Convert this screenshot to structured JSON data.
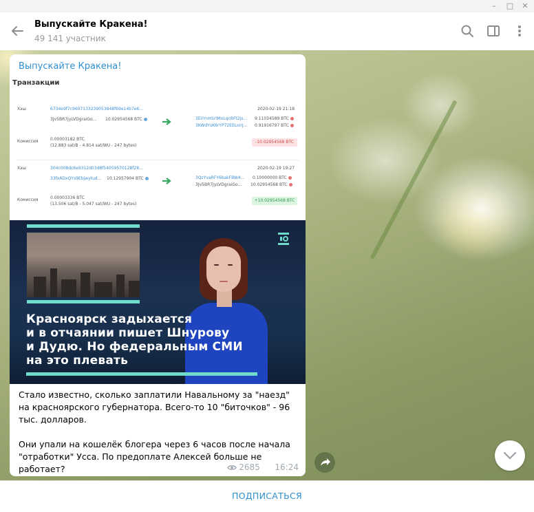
{
  "window": {
    "minimize": "–",
    "maximize": "□",
    "close": "✕"
  },
  "header": {
    "title": "Выпускайте Кракена!",
    "subtitle": "49 141 участник"
  },
  "message": {
    "channel_name": "Выпускайте Кракена!",
    "document": {
      "title": "Транзакции",
      "tx1": {
        "hash_label": "Хэш",
        "hash": "6734e9f7c9607133239053848f69e14b7e6...",
        "date": "2020-02-19 21:18",
        "from_addr": "3Jv5BR7JyLVDgraiGo...",
        "from_amount": "10.02954568 BTC",
        "out1_addr": "3EiiYnHSrtMoLqcBFt2js...",
        "out1_amount": "9.11034589 BTC",
        "out2_addr": "3KWdYsK6rYP72EELoirJ...",
        "out2_amount": "0.91916797 BTC",
        "fee_label": "Комиссия",
        "fee": "0.00003182 BTC",
        "fee_detail": "(12.883 sat/B - 4.814 sat/WU - 247 bytes)",
        "total": "-10.02954568 BTC"
      },
      "tx2": {
        "hash_label": "Хэш",
        "hash": "304c008dc6e9312d03d8f54059570128f28...",
        "date": "2020-02-19 19:27",
        "from_addr": "33fxADxQYs9Ebjwytud...",
        "from_amount": "10.12957904 BTC",
        "out1_addr": "3QzYvaRFY6bakFBW4...",
        "out1_amount": "0.10000000 BTC",
        "out2_addr": "3Jv5BR7JyLVDgraiGo...",
        "out2_amount": "10.02954568 BTC",
        "fee_label": "Комиссия",
        "fee": "0.00003336 BTC",
        "fee_detail": "(13.506 sat/B - 5.047 sat/WU - 247 bytes)",
        "total": "+10.02954568 BTC"
      }
    },
    "video": {
      "headline_lines": [
        "Красноярск задыхается",
        "и в отчаянии пишет Шнурову",
        "и Дудю. Но федеральным СМИ",
        "на это плевать"
      ]
    },
    "caption_p1": "Стало известно, сколько заплатили Навальному за \"наезд\" на красноярского губернатора. Всего-то 10 \"биточков\" - 96 тыс. долларов.",
    "caption_p2": "Они упали на кошелёк блогера через 6 часов после начала \"отработки\" Усса. По предоплате Алексей больше не работает?",
    "views": "2685",
    "time": "16:24"
  },
  "footer": {
    "subscribe_label": "ПОДПИСАТЬСЯ"
  },
  "colors": {
    "accent": "#2f8ed0",
    "fee_negative": "#d04848",
    "fee_positive": "#2e9a4c",
    "video_line": "#6fdccb"
  },
  "icons": [
    "back-arrow-icon",
    "search-icon",
    "sidebar-toggle-icon",
    "more-vertical-icon",
    "eye-icon",
    "share-icon",
    "chevron-down-icon"
  ]
}
